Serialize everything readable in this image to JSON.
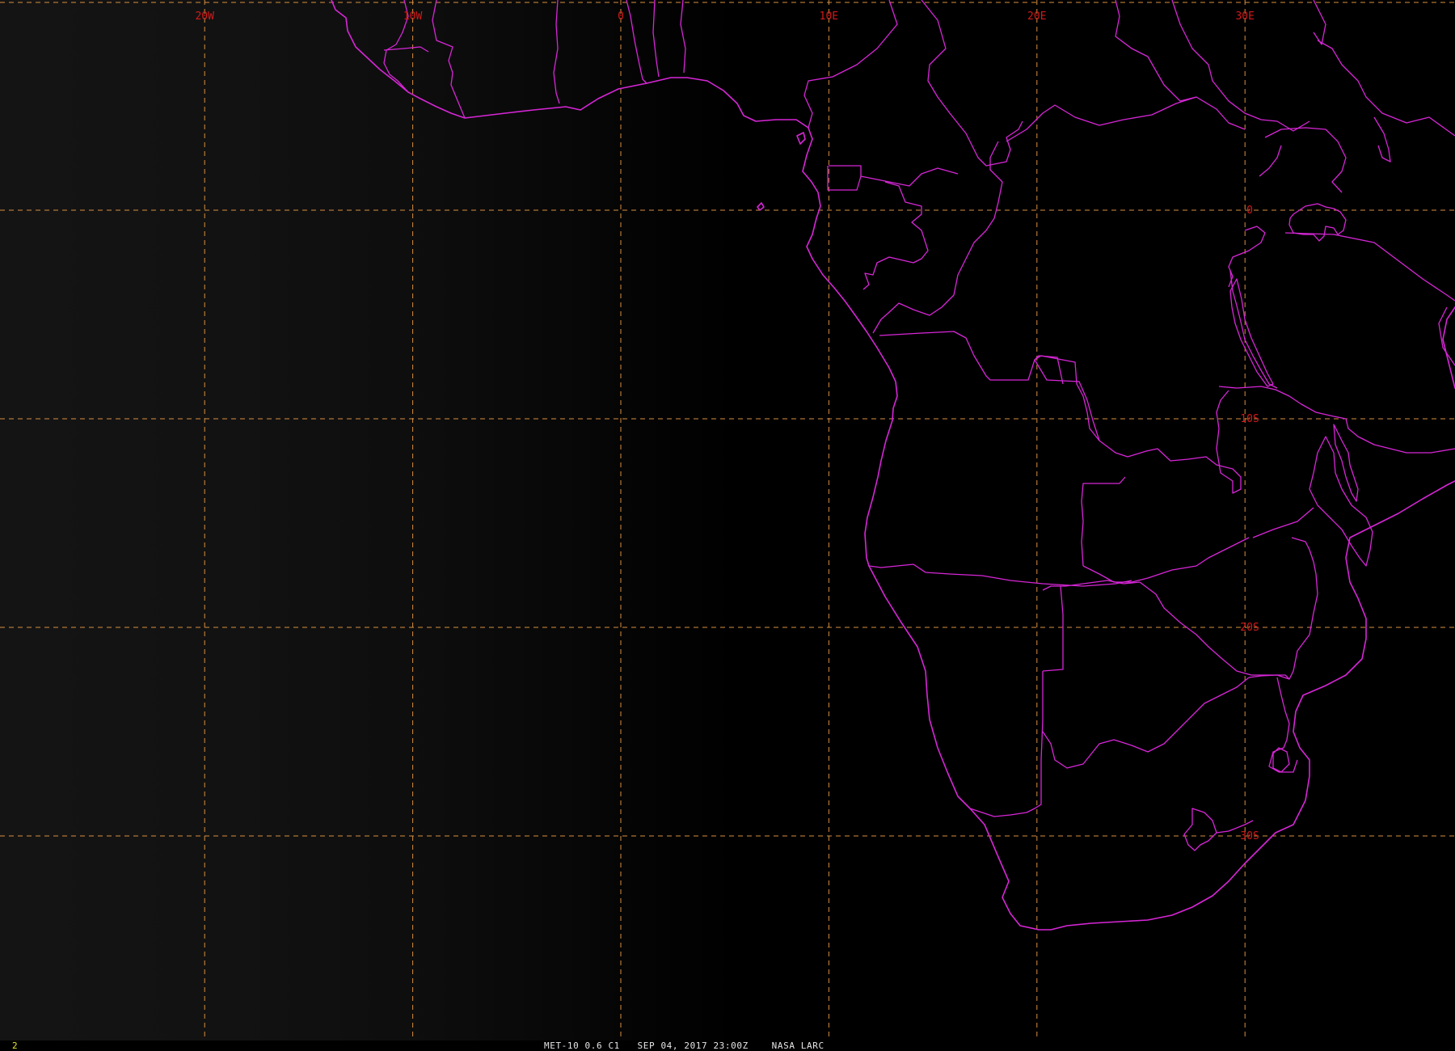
{
  "map": {
    "grid_longitudes": [
      {
        "value": -20,
        "label": "20W"
      },
      {
        "value": -10,
        "label": "10W"
      },
      {
        "value": 0,
        "label": "0"
      },
      {
        "value": 10,
        "label": "10E"
      },
      {
        "value": 20,
        "label": "20E"
      },
      {
        "value": 30,
        "label": "30E"
      }
    ],
    "grid_latitudes": [
      {
        "value": 0,
        "label": "0"
      },
      {
        "value": -10,
        "label": "10S"
      },
      {
        "value": -20,
        "label": "20S"
      },
      {
        "value": -30,
        "label": "30S"
      }
    ],
    "colors": {
      "background": "#000000",
      "grid": "#d88f40",
      "grid_labels": "#d21a1a",
      "political_boundaries": "#d726d7",
      "frame_number": "#e6e632",
      "caption": "#e6e6e6"
    }
  },
  "status_bar": {
    "frame_number": "2",
    "caption": "MET-10 0.6 C1   SEP 04, 2017 23:00Z    NASA LARC"
  }
}
